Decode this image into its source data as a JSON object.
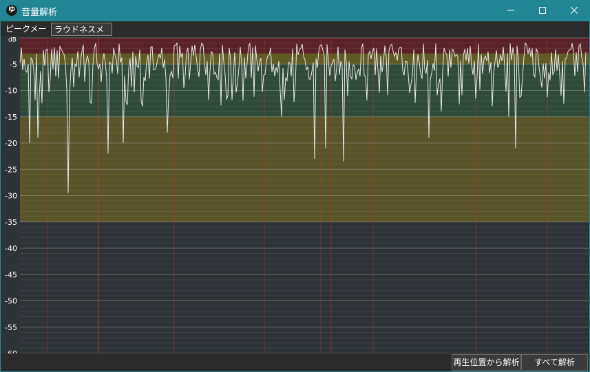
{
  "window": {
    "title": "音量解析",
    "icon_glyph": "ゆ",
    "controls": [
      "minimize-icon",
      "maximize-icon",
      "close-icon"
    ]
  },
  "tabs": [
    {
      "label": "ピークメーター",
      "selected": false
    },
    {
      "label": "ラウドネスメーター",
      "selected": true
    }
  ],
  "meter": {
    "unit_label": "dB",
    "ticks": [
      "-5",
      "-10",
      "-15",
      "-20",
      "-25",
      "-30",
      "-35",
      "-40",
      "-45",
      "-50",
      "-55",
      "-60"
    ],
    "zones": [
      {
        "from_db": 0,
        "to_db": -3,
        "color": "#5a2228"
      },
      {
        "from_db": -3,
        "to_db": -5,
        "color": "#5f5a22"
      },
      {
        "from_db": -5,
        "to_db": -15,
        "color": "#2f4a38"
      },
      {
        "from_db": -15,
        "to_db": -35,
        "color": "#5a5528"
      },
      {
        "from_db": -35,
        "to_db": -60,
        "color": "#2e3338"
      }
    ],
    "trace_color": "#e8e8e8",
    "marker_color": "#c0392b"
  },
  "actions": {
    "from_position_label": "再生位置から解析",
    "all_label": "すべて解析"
  }
}
